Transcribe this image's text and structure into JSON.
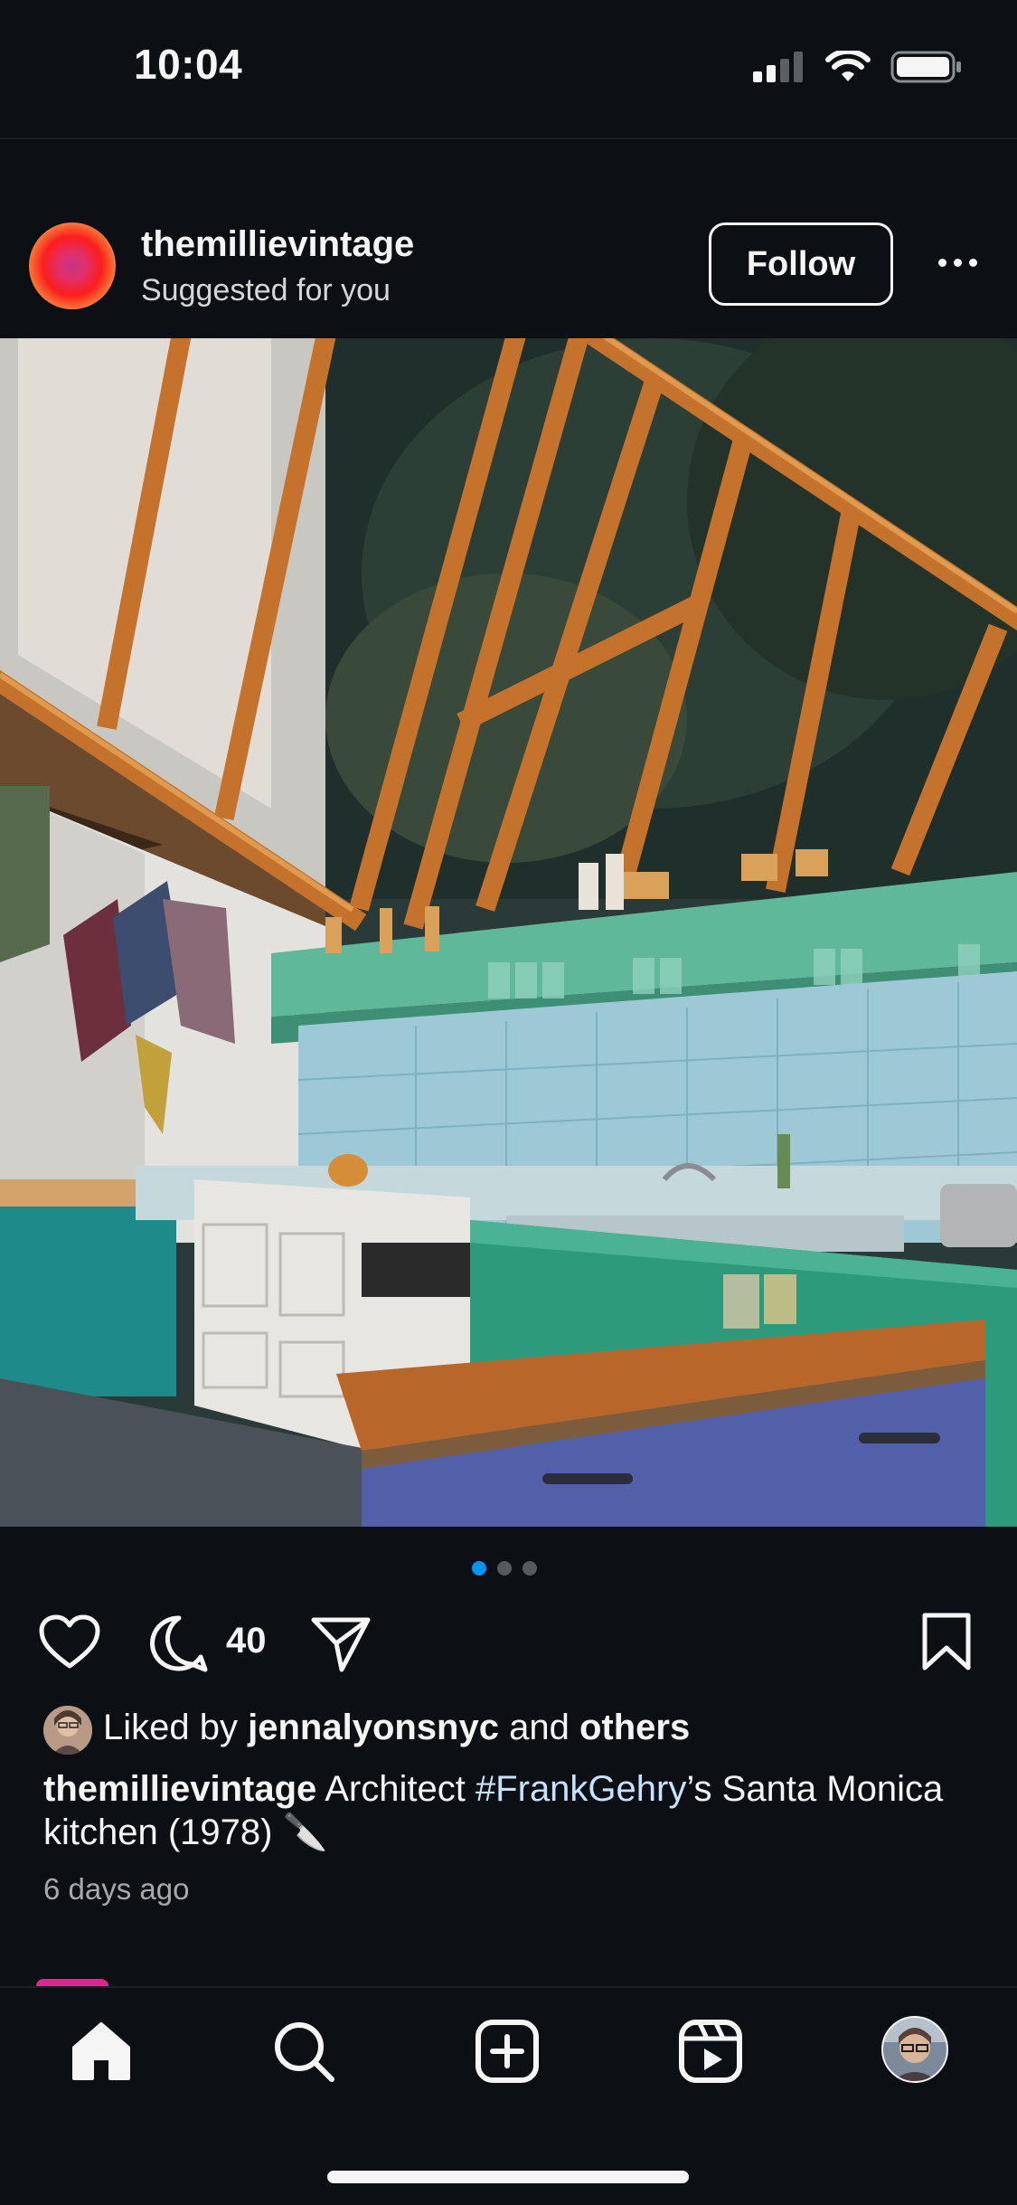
{
  "status_bar": {
    "time": "10:04",
    "icons": [
      "cellular-signal-icon",
      "wifi-icon",
      "battery-icon"
    ]
  },
  "post": {
    "username": "themillievintage",
    "subtitle": "Suggested for you",
    "follow_label": "Follow",
    "carousel": {
      "count": 3,
      "active_index": 0
    },
    "comment_count": "40",
    "liked_by_prefix": "Liked by ",
    "liked_by_user": "jennalyonsnyc",
    "liked_by_and": " and ",
    "liked_by_others": "others",
    "caption_user": "themillievintage",
    "caption_text_1": " Architect ",
    "caption_hashtag": "#FrankGehry",
    "caption_text_2": "’s Santa Monica kitchen (1978) 🔪",
    "time_ago": "6 days ago"
  },
  "colors": {
    "background": "#0c1014",
    "text": "#f5f5f5",
    "active_dot": "#0095f6",
    "muted": "#a8a8a8"
  },
  "bottom_nav": [
    "home-icon",
    "search-icon",
    "create-icon",
    "reels-icon",
    "profile-avatar"
  ]
}
